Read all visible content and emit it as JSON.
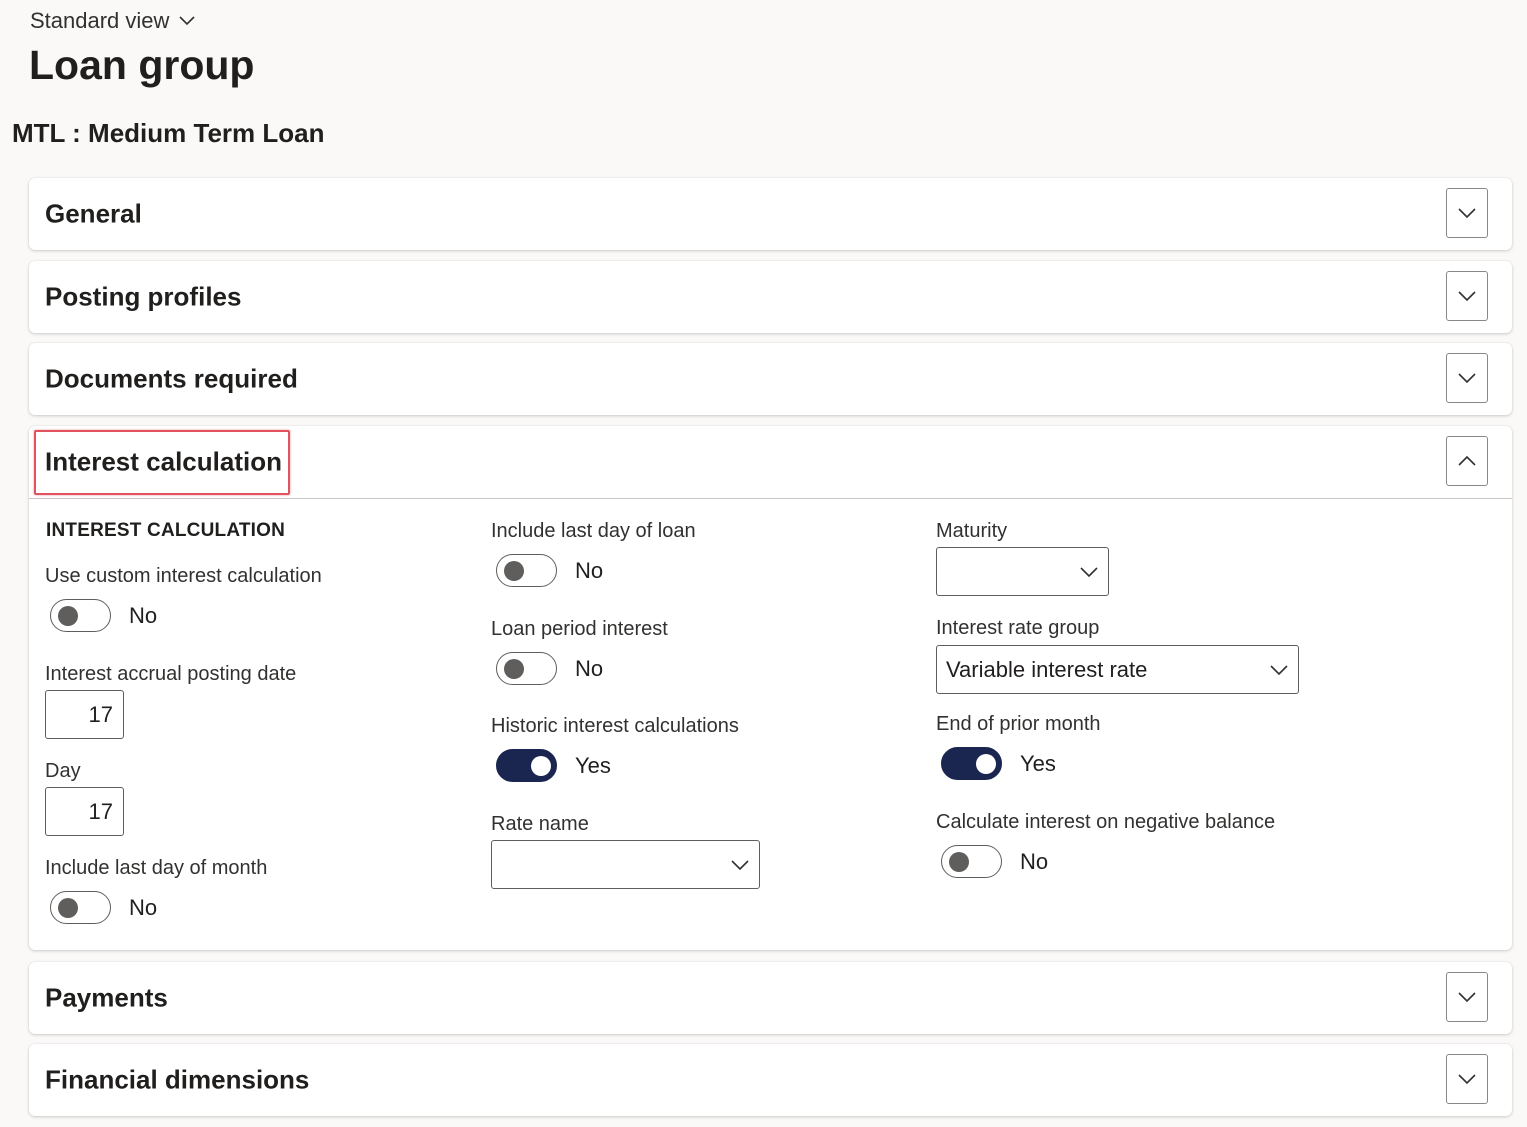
{
  "header": {
    "view_label": "Standard view",
    "page_title": "Loan group",
    "record_title": "MTL : Medium Term Loan"
  },
  "fasttabs": {
    "general": {
      "title": "General",
      "expanded": false
    },
    "posting_profiles": {
      "title": "Posting profiles",
      "expanded": false
    },
    "documents_required": {
      "title": "Documents required",
      "expanded": false
    },
    "interest_calculation": {
      "title": "Interest calculation",
      "expanded": true
    },
    "payments": {
      "title": "Payments",
      "expanded": false
    },
    "financial_dimensions": {
      "title": "Financial dimensions",
      "expanded": false
    }
  },
  "interest": {
    "section_heading": "INTEREST CALCULATION",
    "use_custom": {
      "label": "Use custom interest calculation",
      "value": "No"
    },
    "accrual_posting_date": {
      "label": "Interest accrual posting date",
      "value": "17"
    },
    "day": {
      "label": "Day",
      "value": "17"
    },
    "include_last_day_month": {
      "label": "Include last day of month",
      "value": "No"
    },
    "include_last_day_loan": {
      "label": "Include last day of loan",
      "value": "No"
    },
    "loan_period_interest": {
      "label": "Loan period interest",
      "value": "No"
    },
    "historic_interest": {
      "label": "Historic interest calculations",
      "value": "Yes"
    },
    "rate_name": {
      "label": "Rate name",
      "value": ""
    },
    "maturity": {
      "label": "Maturity",
      "value": ""
    },
    "interest_rate_group": {
      "label": "Interest rate group",
      "value": "Variable interest rate"
    },
    "end_of_prior_month": {
      "label": "End of prior month",
      "value": "Yes"
    },
    "negative_balance": {
      "label": "Calculate interest on negative balance",
      "value": "No"
    }
  },
  "icons": {
    "collapsed": "chevron-down-icon",
    "expanded": "chevron-up-icon",
    "dropdown": "chevron-down-icon"
  },
  "colors": {
    "toggle_on": "#1b2650",
    "highlight": "#e0535f",
    "background": "#faf9f8"
  }
}
